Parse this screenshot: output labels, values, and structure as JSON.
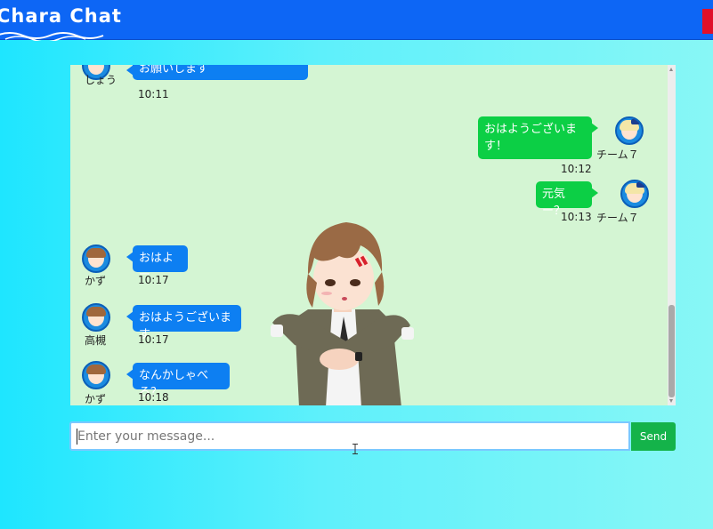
{
  "app": {
    "logo": "Chara Chat"
  },
  "messages": [
    {
      "side": "left",
      "avatar": "avatar-boy-icon",
      "name": "しょう",
      "text": "お願いします",
      "time": "10:11"
    },
    {
      "side": "right",
      "avatar": "avatar-blonde-girl-icon",
      "name": "チーム７",
      "text": "おはようございま\nす！",
      "time": "10:12"
    },
    {
      "side": "right",
      "avatar": "avatar-blonde-girl-icon",
      "name": "チーム７",
      "text": "元気ー？",
      "time": "10:13"
    },
    {
      "side": "left",
      "avatar": "avatar-brown-girl-icon",
      "name": "かず",
      "text": "おはよー",
      "time": "10:17"
    },
    {
      "side": "left",
      "avatar": "avatar-brown-girl-icon",
      "name": "高槻",
      "text": "おはようございます",
      "time": "10:17"
    },
    {
      "side": "left",
      "avatar": "avatar-brown-girl-icon",
      "name": "かず",
      "text": "なんかしゃべろ？",
      "time": "10:18"
    }
  ],
  "composer": {
    "placeholder": "Enter your message...",
    "send_label": "Send"
  },
  "colors": {
    "header": "#0d66f5",
    "chat_background": "#d4f5d3",
    "left_bubble": "#0d7ff2",
    "right_bubble": "#0ccf45",
    "send_button": "#14b34a"
  }
}
